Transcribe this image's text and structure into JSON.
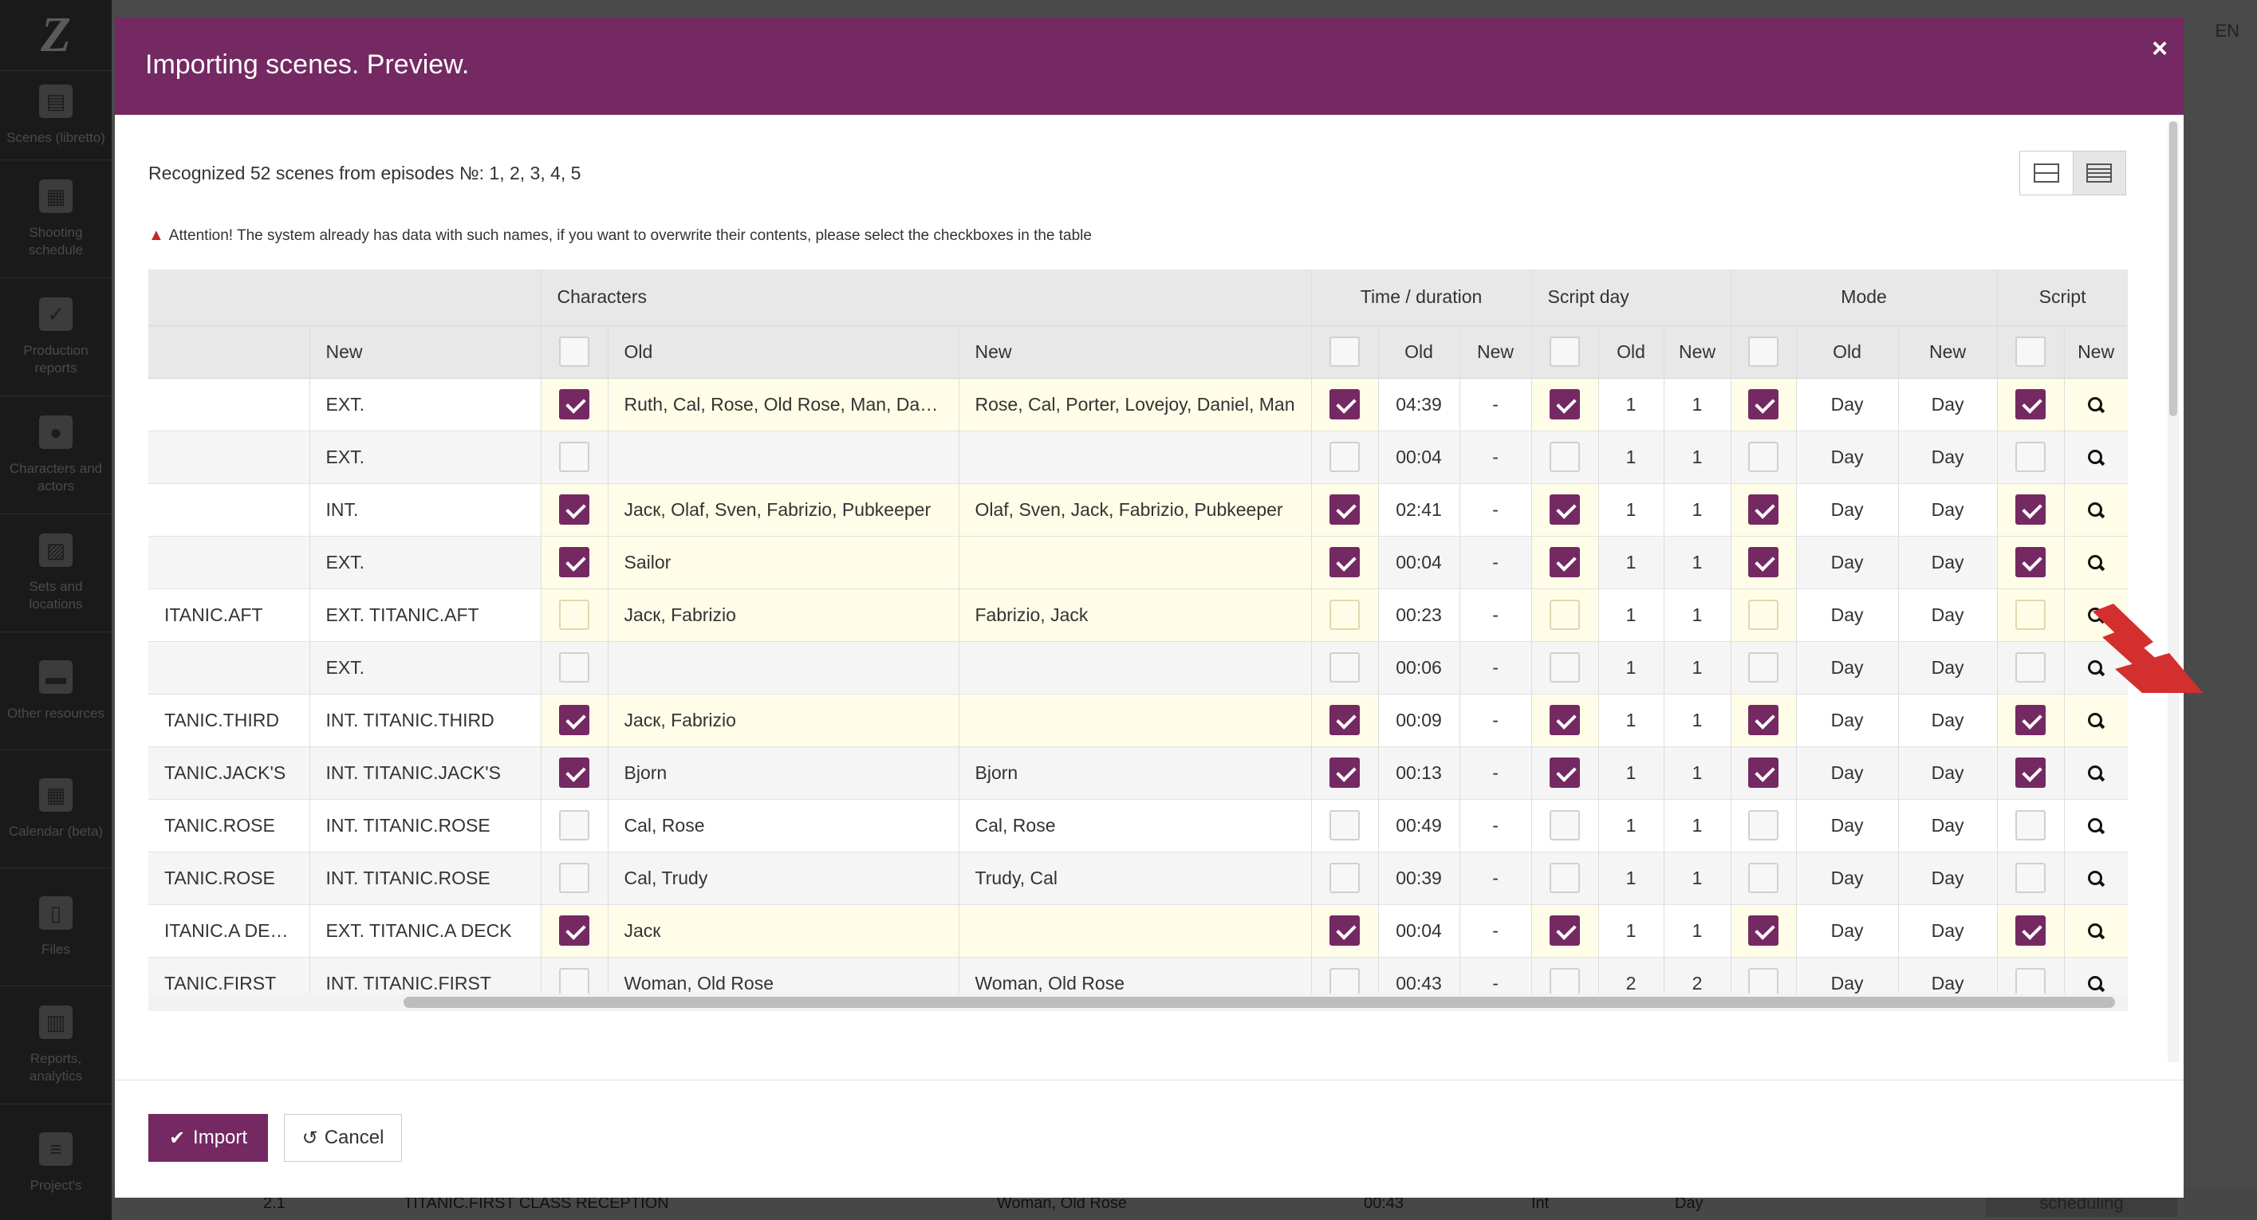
{
  "sidebar": {
    "logo": "Z",
    "items": [
      {
        "label": "Scenes (libretto)",
        "icon": "clapperboard-icon"
      },
      {
        "label": "Shooting schedule",
        "icon": "calendar-grid-icon"
      },
      {
        "label": "Production reports",
        "icon": "checkbox-icon"
      },
      {
        "label": "Characters and actors",
        "icon": "people-icon"
      },
      {
        "label": "Sets and locations",
        "icon": "picture-icon"
      },
      {
        "label": "Other resources",
        "icon": "box-icon"
      },
      {
        "label": "Calendar (beta)",
        "icon": "calendar-icon"
      },
      {
        "label": "Files",
        "icon": "file-icon"
      },
      {
        "label": "Reports, analytics",
        "icon": "bar-chart-icon"
      },
      {
        "label": "Project's",
        "icon": "sliders-icon"
      }
    ]
  },
  "background": {
    "language": "EN",
    "row": {
      "num": "2.1",
      "location": "TITANIC.FIRST CLASS RECEPTION",
      "characters": "Woman, Old Rose",
      "time": "00:43",
      "mode": "Int",
      "day": "Day",
      "badge": "scheduling"
    }
  },
  "modal": {
    "title": "Importing scenes. Preview.",
    "close": "×",
    "recognized": "Recognized 52 scenes from episodes №: 1, 2, 3, 4, 5",
    "attention": "Attention! The system already has data with such names, if you want to overwrite their contents, please select the checkboxes in the table",
    "colors": {
      "accent": "#742962",
      "highlight": "#fffde7"
    },
    "table": {
      "groups": {
        "characters": "Characters",
        "time": "Time / duration",
        "script_day": "Script day",
        "mode": "Mode",
        "script": "Script"
      },
      "sub": {
        "new": "New",
        "old": "Old"
      },
      "rows": [
        {
          "loc_old": "",
          "loc_new": "EXT.",
          "ch_on": true,
          "ch_old": "Ruth, Cal, Rose, Old Rose, Man, Daniel, Lovejoy",
          "ch_new": "Rose, Cal, Porter, Lovejoy, Daniel, Man",
          "t_on": true,
          "t_old": "04:39",
          "t_new": "-",
          "d_on": true,
          "d_old": "1",
          "d_new": "1",
          "m_on": true,
          "m_old": "Day",
          "m_new": "Day",
          "s_on": true,
          "hl": true
        },
        {
          "loc_old": "",
          "loc_new": "EXT.",
          "ch_on": false,
          "ch_old": "",
          "ch_new": "",
          "t_on": false,
          "t_old": "00:04",
          "t_new": "-",
          "d_on": false,
          "d_old": "1",
          "d_new": "1",
          "m_on": false,
          "m_old": "Day",
          "m_new": "Day",
          "s_on": false,
          "hl": false
        },
        {
          "loc_old": "",
          "loc_new": "INT.",
          "ch_on": true,
          "ch_old": "Jacк, Olaf, Sven, Fabrizio, Pubkeeper",
          "ch_new": "Olaf, Sven, Jack, Fabrizio, Pubkeeper",
          "t_on": true,
          "t_old": "02:41",
          "t_new": "-",
          "d_on": true,
          "d_old": "1",
          "d_new": "1",
          "m_on": true,
          "m_old": "Day",
          "m_new": "Day",
          "s_on": true,
          "hl": true
        },
        {
          "loc_old": "",
          "loc_new": "EXT.",
          "ch_on": true,
          "ch_old": "Sailor",
          "ch_new": "",
          "t_on": true,
          "t_old": "00:04",
          "t_new": "-",
          "d_on": true,
          "d_old": "1",
          "d_new": "1",
          "m_on": true,
          "m_old": "Day",
          "m_new": "Day",
          "s_on": true,
          "hl": true
        },
        {
          "loc_old": "ITANIC.AFT",
          "loc_new": "EXT. TITANIC.AFT",
          "ch_on": false,
          "ch_old": "Jacк, Fabrizio",
          "ch_new": "Fabrizio, Jack",
          "t_on": false,
          "t_old": "00:23",
          "t_new": "-",
          "d_on": false,
          "d_old": "1",
          "d_new": "1",
          "m_on": false,
          "m_old": "Day",
          "m_new": "Day",
          "s_on": false,
          "hl": true
        },
        {
          "loc_old": "",
          "loc_new": "EXT.",
          "ch_on": false,
          "ch_old": "",
          "ch_new": "",
          "t_on": false,
          "t_old": "00:06",
          "t_new": "-",
          "d_on": false,
          "d_old": "1",
          "d_new": "1",
          "m_on": false,
          "m_old": "Day",
          "m_new": "Day",
          "s_on": false,
          "hl": false
        },
        {
          "loc_old": "TANIC.THIRD",
          "loc_new": "INT. TITANIC.THIRD",
          "ch_on": true,
          "ch_old": "Jacк, Fabrizio",
          "ch_new": "",
          "t_on": true,
          "t_old": "00:09",
          "t_new": "-",
          "d_on": true,
          "d_old": "1",
          "d_new": "1",
          "m_on": true,
          "m_old": "Day",
          "m_new": "Day",
          "s_on": true,
          "hl": true
        },
        {
          "loc_old": "TANIC.JACK'S",
          "loc_new": "INT. TITANIC.JACK'S",
          "ch_on": true,
          "ch_old": "Bjorn",
          "ch_new": "Bjorn",
          "t_on": true,
          "t_old": "00:13",
          "t_new": "-",
          "d_on": true,
          "d_old": "1",
          "d_new": "1",
          "m_on": true,
          "m_old": "Day",
          "m_new": "Day",
          "s_on": true,
          "hl": false
        },
        {
          "loc_old": "TANIC.ROSE",
          "loc_new": "INT. TITANIC.ROSE",
          "ch_on": false,
          "ch_old": "Cal, Rose",
          "ch_new": "Cal, Rose",
          "t_on": false,
          "t_old": "00:49",
          "t_new": "-",
          "d_on": false,
          "d_old": "1",
          "d_new": "1",
          "m_on": false,
          "m_old": "Day",
          "m_new": "Day",
          "s_on": false,
          "hl": false
        },
        {
          "loc_old": "TANIC.ROSE",
          "loc_new": "INT. TITANIC.ROSE",
          "ch_on": false,
          "ch_old": "Cal, Trudy",
          "ch_new": "Trudy, Cal",
          "t_on": false,
          "t_old": "00:39",
          "t_new": "-",
          "d_on": false,
          "d_old": "1",
          "d_new": "1",
          "m_on": false,
          "m_old": "Day",
          "m_new": "Day",
          "s_on": false,
          "hl": false
        },
        {
          "loc_old": "ITANIC.A DECK",
          "loc_new": "EXT. TITANIC.A DECK",
          "ch_on": true,
          "ch_old": "Jacк",
          "ch_new": "",
          "t_on": true,
          "t_old": "00:04",
          "t_new": "-",
          "d_on": true,
          "d_old": "1",
          "d_new": "1",
          "m_on": true,
          "m_old": "Day",
          "m_new": "Day",
          "s_on": true,
          "hl": true
        },
        {
          "loc_old": "TANIC.FIRST",
          "loc_new": "INT. TITANIC.FIRST",
          "ch_on": false,
          "ch_old": "Woman, Old Rose",
          "ch_new": "Woman, Old Rose",
          "t_on": false,
          "t_old": "00:43",
          "t_new": "-",
          "d_on": false,
          "d_old": "2",
          "d_new": "2",
          "m_on": false,
          "m_old": "Day",
          "m_new": "Day",
          "s_on": false,
          "hl": false
        }
      ]
    },
    "buttons": {
      "import": "Import",
      "cancel": "Cancel"
    }
  }
}
